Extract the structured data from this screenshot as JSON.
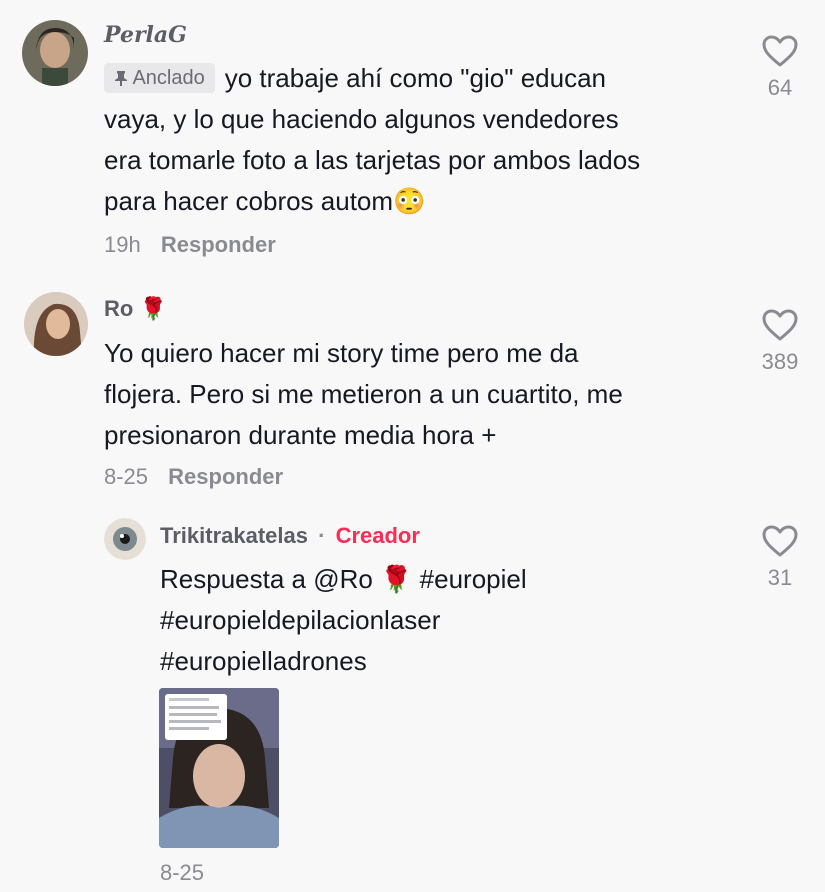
{
  "comments": [
    {
      "username": "PerlaG",
      "pinned_label": "Anclado",
      "text_lines": [
        "yo trabaje ahí como \"gio\" educan",
        "vaya, y lo que haciendo algunos vendedores",
        "era tomarle foto a las tarjetas por ambos lados",
        "para hacer cobros autom😳"
      ],
      "time": "19h",
      "reply_label": "Responder",
      "likes": "64"
    },
    {
      "username": "Ro 🌹",
      "text_lines": [
        "Yo quiero hacer mi story time pero me da",
        "flojera. Pero si me metieron a un cuartito, me",
        "presionaron durante media hora +"
      ],
      "time": "8-25",
      "reply_label": "Responder",
      "likes": "389"
    }
  ],
  "reply": {
    "username": "Trikitrakatelas",
    "separator": "·",
    "creator_label": "Creador",
    "text_lines": [
      "Respuesta a @Ro 🌹 #europiel",
      "#europieldepilacionlaser",
      "#europielladrones"
    ],
    "time": "8-25",
    "likes": "31"
  },
  "icons": {
    "like": "heart-outline-icon",
    "pin": "pin-icon"
  },
  "colors": {
    "creator": "#fe2c55",
    "muted": "#8a8b91"
  }
}
